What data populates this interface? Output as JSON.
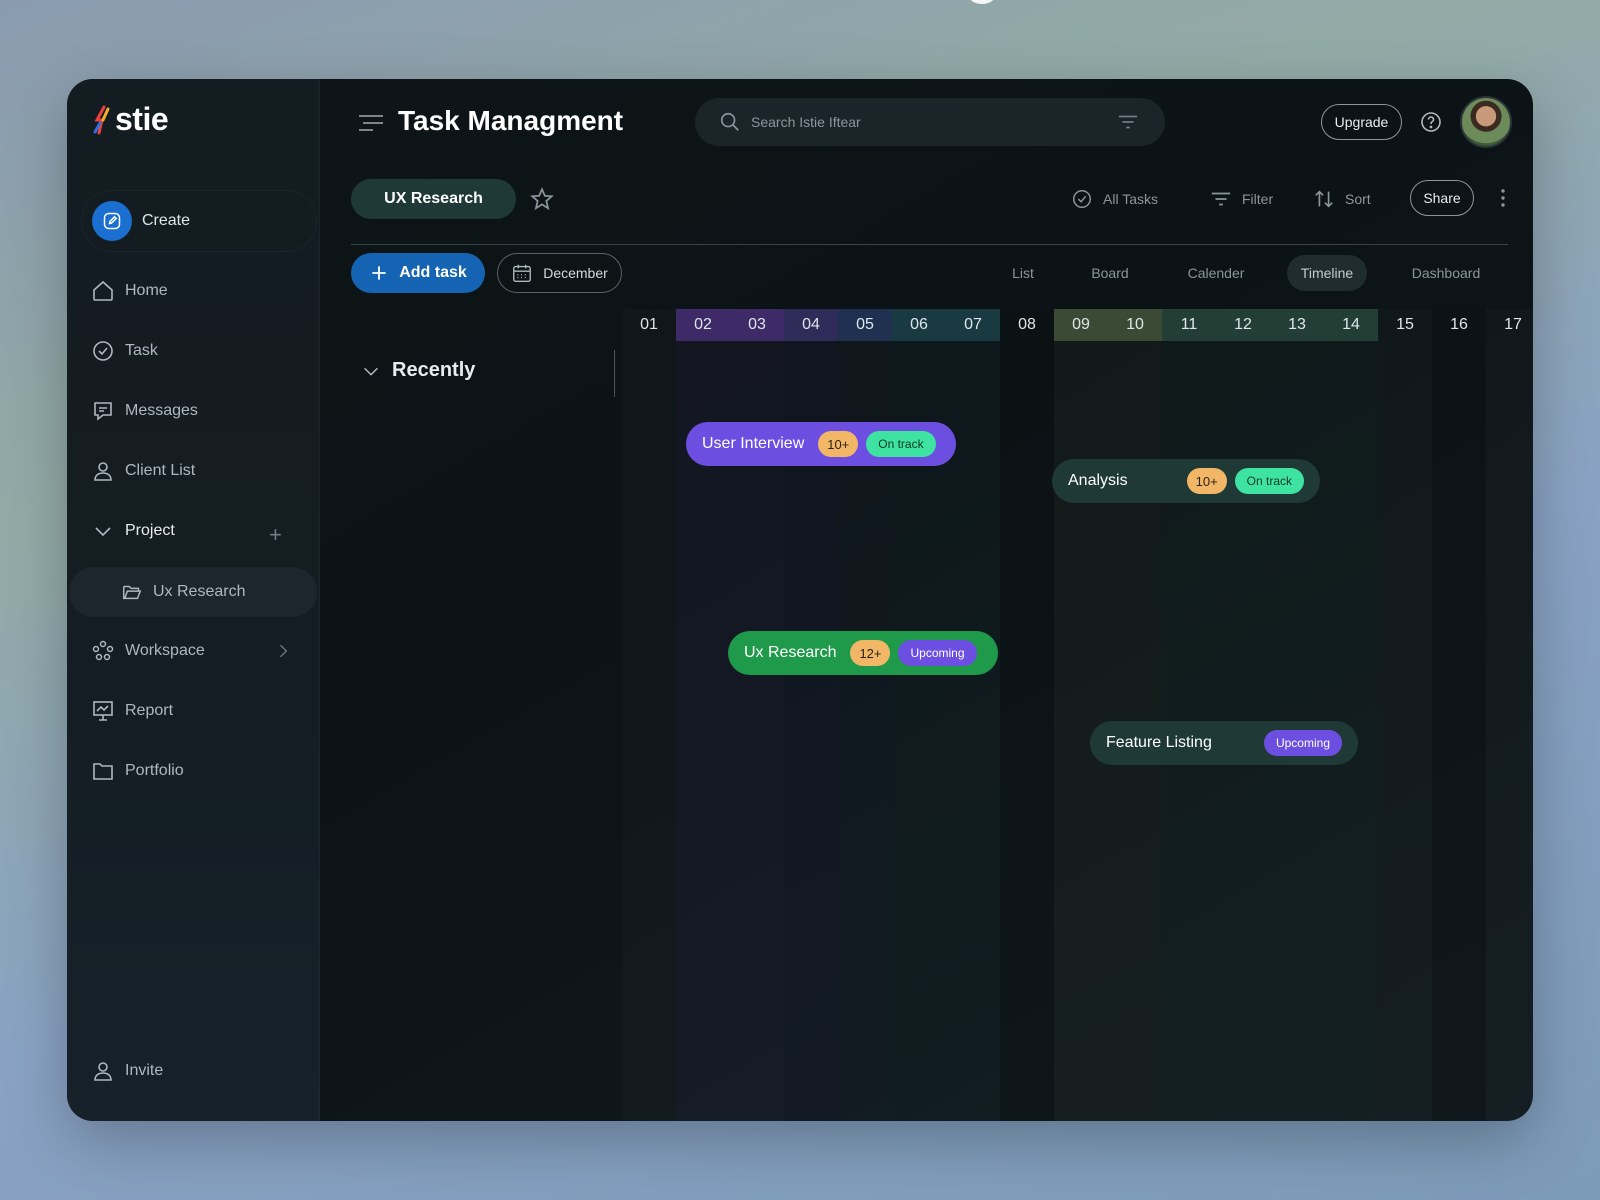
{
  "app": {
    "logo_text": "stie",
    "title": "Task Managment",
    "search_placeholder": "Search Istie Iftear",
    "upgrade_label": "Upgrade",
    "share_label": "Share"
  },
  "sidebar": {
    "create_label": "Create",
    "items": [
      {
        "label": "Home",
        "icon": "home-icon"
      },
      {
        "label": "Task",
        "icon": "check-circle-icon"
      },
      {
        "label": "Messages",
        "icon": "message-icon"
      },
      {
        "label": "Client List",
        "icon": "user-icon"
      },
      {
        "label": "Project",
        "icon": "chevron-down-icon"
      },
      {
        "label": "Ux Research",
        "icon": "folder-open-icon"
      },
      {
        "label": "Workspace",
        "icon": "workspace-icon"
      },
      {
        "label": "Report",
        "icon": "presentation-icon"
      },
      {
        "label": "Portfolio",
        "icon": "folder-icon"
      }
    ],
    "invite_label": "Invite"
  },
  "toolbar": {
    "project_tab": "UX Research",
    "all_tasks": "All Tasks",
    "filter": "Filter",
    "sort": "Sort",
    "add_task": "Add task",
    "month": "December"
  },
  "views": [
    {
      "label": "List",
      "active": false
    },
    {
      "label": "Board",
      "active": false
    },
    {
      "label": "Calender",
      "active": false
    },
    {
      "label": "Timeline",
      "active": true
    },
    {
      "label": "Dashboard",
      "active": false
    }
  ],
  "group": {
    "label": "Recently"
  },
  "timeline": {
    "days": [
      {
        "label": "01",
        "tint": "none"
      },
      {
        "label": "02",
        "tint": "purple"
      },
      {
        "label": "03",
        "tint": "purple"
      },
      {
        "label": "04",
        "tint": "indigo"
      },
      {
        "label": "05",
        "tint": "blue"
      },
      {
        "label": "06",
        "tint": "teal"
      },
      {
        "label": "07",
        "tint": "teal"
      },
      {
        "label": "08",
        "tint": "none"
      },
      {
        "label": "09",
        "tint": "olive"
      },
      {
        "label": "10",
        "tint": "olive"
      },
      {
        "label": "11",
        "tint": "green"
      },
      {
        "label": "12",
        "tint": "green"
      },
      {
        "label": "13",
        "tint": "green"
      },
      {
        "label": "14",
        "tint": "green"
      },
      {
        "label": "15",
        "tint": "none"
      },
      {
        "label": "16",
        "tint": "none"
      },
      {
        "label": "17",
        "tint": "none"
      }
    ],
    "tasks": [
      {
        "name": "User Interview",
        "count": "10+",
        "status": "On track",
        "color": "#6c4fe0",
        "status_type": "on"
      },
      {
        "name": "Analysis",
        "count": "10+",
        "status": "On track",
        "color": "#1f3a36",
        "status_type": "on"
      },
      {
        "name": "Ux Research",
        "count": "12+",
        "status": "Upcoming",
        "color": "#1f9a4a",
        "status_type": "up"
      },
      {
        "name": "Feature Listing",
        "count": "",
        "status": "Upcoming",
        "color": "#1f3a36",
        "status_type": "up"
      }
    ]
  },
  "colors": {
    "accent": "#1564b3",
    "on_track": "#3ee3a2",
    "upcoming": "#6c4fe0",
    "count_badge": "#f2b766"
  }
}
